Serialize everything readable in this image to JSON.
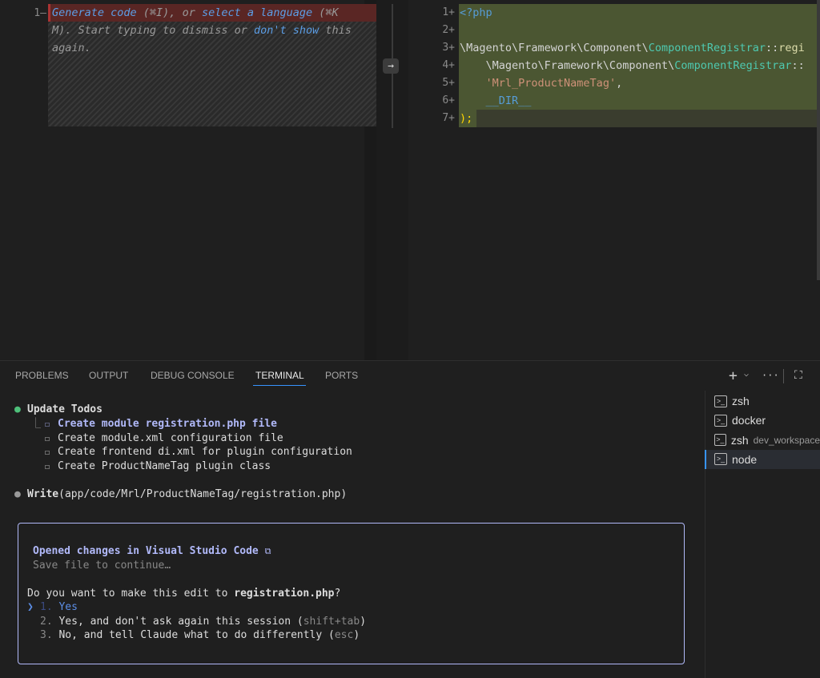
{
  "left_editor": {
    "line_number": "1—",
    "hint_part1": "Generate code",
    "hint_part2": " (⌘I), or ",
    "hint_part3": "select a language",
    "hint_part4": " (⌘K",
    "hint_line2a": "M). Start typing to dismiss or ",
    "hint_line2_link": "don't show",
    "hint_line2b": " this",
    "hint_line3": "again."
  },
  "apply_arrow": "→",
  "right_editor": {
    "lines": [
      {
        "num": "1+",
        "parts": [
          {
            "t": "<?php",
            "c": "#569cd6"
          }
        ]
      },
      {
        "num": "2+",
        "parts": []
      },
      {
        "num": "3+",
        "parts": [
          {
            "t": "\\Magento\\Framework\\Component\\",
            "c": "#d4d4d4"
          },
          {
            "t": "ComponentRegistrar",
            "c": "#4ec9b0"
          },
          {
            "t": "::",
            "c": "#d4d4d4"
          },
          {
            "t": "regi",
            "c": "#dcdcaa"
          }
        ]
      },
      {
        "num": "4+",
        "parts": [
          {
            "t": "    \\Magento\\Framework\\Component\\",
            "c": "#d4d4d4"
          },
          {
            "t": "ComponentRegistrar",
            "c": "#4ec9b0"
          },
          {
            "t": "::",
            "c": "#d4d4d4"
          }
        ]
      },
      {
        "num": "5+",
        "parts": [
          {
            "t": "    ",
            "c": "#d4d4d4"
          },
          {
            "t": "'Mrl_ProductNameTag'",
            "c": "#ce9178"
          },
          {
            "t": ",",
            "c": "#d4d4d4"
          }
        ]
      },
      {
        "num": "6+",
        "parts": [
          {
            "t": "    ",
            "c": "#d4d4d4"
          },
          {
            "t": "__DIR__",
            "c": "#569cd6"
          }
        ]
      },
      {
        "num": "7+",
        "parts": [
          {
            "t": ");",
            "c": "#ffd700"
          }
        ]
      }
    ]
  },
  "panel": {
    "tabs": [
      "PROBLEMS",
      "OUTPUT",
      "DEBUG CONSOLE",
      "TERMINAL",
      "PORTS"
    ],
    "active_tab": "TERMINAL",
    "new_terminal": "+",
    "dropdown": "⌵",
    "more": "···",
    "maximize": "⛶"
  },
  "terminal": {
    "todos_title": "Update Todos",
    "todos": [
      "Create module registration.php file",
      "Create module.xml configuration file",
      "Create frontend di.xml for plugin configuration",
      "Create ProductNameTag plugin class"
    ],
    "write_tool": "Write",
    "write_path": "(app/code/Mrl/ProductNameTag/registration.php)",
    "dialog": {
      "opened": "Opened changes in Visual Studio Code",
      "save_hint": "Save file to continue…",
      "question_a": "Do you want to make this edit to ",
      "question_file": "registration.php",
      "question_b": "?",
      "options": [
        {
          "num": "1.",
          "label": "Yes",
          "hint": ""
        },
        {
          "num": "2.",
          "label": "Yes, and don't ask again this session (",
          "hint": "shift+tab",
          "end": ")"
        },
        {
          "num": "3.",
          "label": "No, and tell Claude what to do differently (",
          "hint": "esc",
          "end": ")"
        }
      ],
      "selector": "❯"
    }
  },
  "terminal_list": [
    {
      "name": "zsh",
      "sub": ""
    },
    {
      "name": "docker",
      "sub": ""
    },
    {
      "name": "zsh",
      "sub": "dev_workspace"
    },
    {
      "name": "node",
      "sub": ""
    }
  ],
  "colors": {
    "accent": "#3794ff",
    "todo_active": "#b1b9f9",
    "dialog_border": "#b1b9f9",
    "green_dot": "#4ec07a"
  }
}
